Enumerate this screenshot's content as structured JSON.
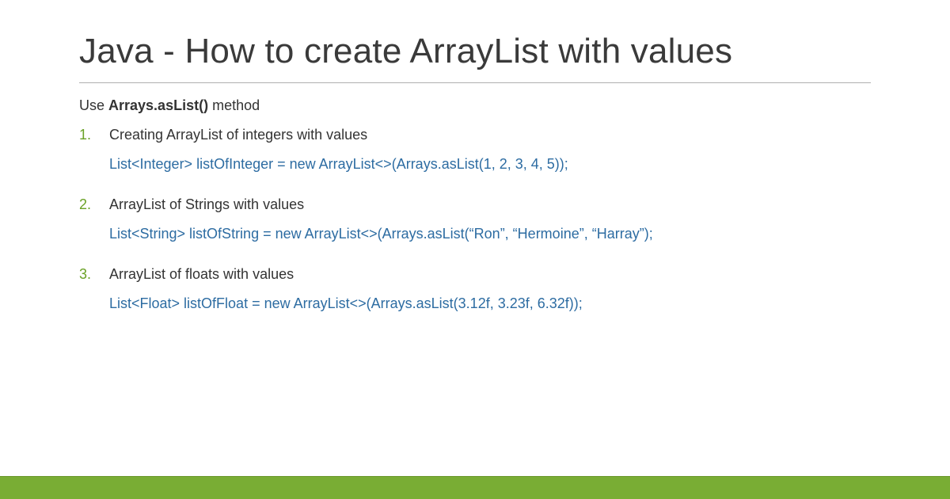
{
  "title": "Java - How to create ArrayList with values",
  "intro_prefix": "Use ",
  "intro_method": "Arrays.asList()",
  "intro_suffix": " method",
  "examples": [
    {
      "label": "Creating ArrayList of integers with values",
      "code": "List<Integer> listOfInteger = new ArrayList<>(Arrays.asList(1, 2, 3, 4, 5));"
    },
    {
      "label": "ArrayList of Strings with values",
      "code": "List<String> listOfString = new ArrayList<>(Arrays.asList(“Ron”, “Hermoine”, “Harray”);"
    },
    {
      "label": "ArrayList of floats with values",
      "code": "List<Float> listOfFloat = new ArrayList<>(Arrays.asList(3.12f, 3.23f, 6.32f));"
    }
  ],
  "colors": {
    "accent": "#79ad34",
    "code": "#2d6ca2"
  }
}
